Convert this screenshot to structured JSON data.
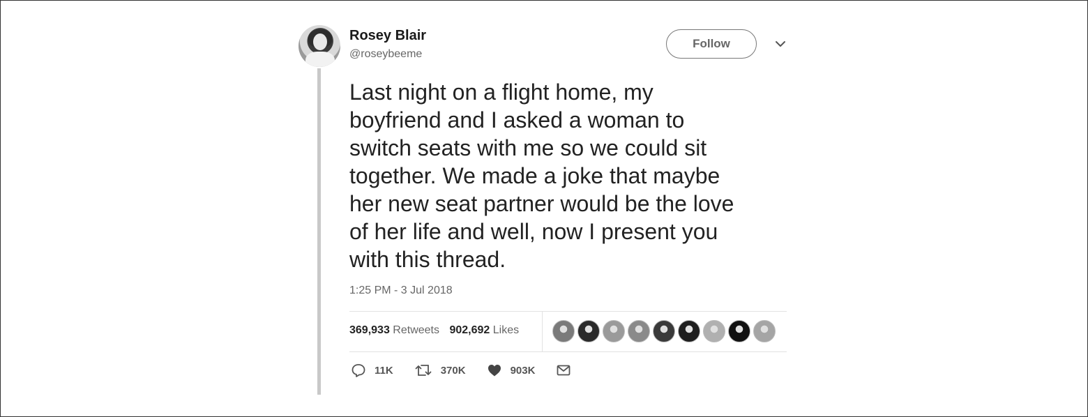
{
  "user": {
    "display_name": "Rosey Blair",
    "handle": "@roseybeeme"
  },
  "follow_label": "Follow",
  "tweet": {
    "text": "Last night on a flight home, my\nboyfriend and I asked a woman to\nswitch seats with me so we could sit\ntogether. We made a joke that maybe\nher new seat partner would be the love\nof her life and well, now I present you\nwith this thread.",
    "timestamp": "1:25 PM - 3 Jul 2018"
  },
  "stats": {
    "retweets_count": "369,933",
    "retweets_label": "Retweets",
    "likes_count": "902,692",
    "likes_label": "Likes"
  },
  "likers": [
    "#7a7a7a",
    "#2a2a2a",
    "#9a9a9a",
    "#8a8a8a",
    "#3a3a3a",
    "#1e1e1e",
    "#b0b0b0",
    "#111111",
    "#a5a5a5"
  ],
  "actions": {
    "replies": "11K",
    "retweets": "370K",
    "likes": "903K"
  },
  "icons": {
    "reply": "reply-icon",
    "retweet": "retweet-icon",
    "like": "heart-icon",
    "dm": "envelope-icon",
    "menu": "chevron-down-icon"
  }
}
